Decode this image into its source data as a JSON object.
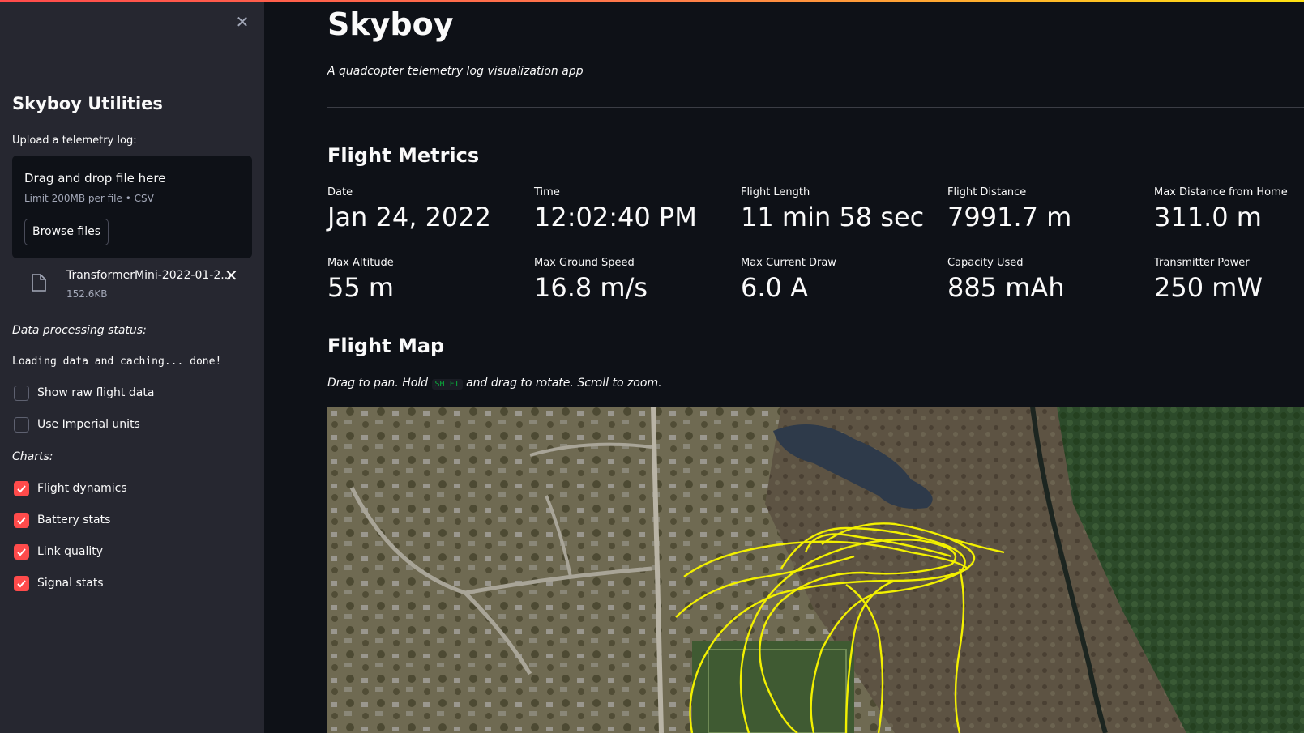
{
  "sidebar": {
    "title": "Skyboy Utilities",
    "upload_label": "Upload a telemetry log:",
    "dropzone": {
      "title": "Drag and drop file here",
      "limit": "Limit 200MB per file • CSV",
      "browse_label": "Browse files"
    },
    "file": {
      "name": "TransformerMini-2022-01-2...",
      "size": "152.6KB"
    },
    "status_label": "Data processing status:",
    "status_text": "Loading data and caching... done!",
    "options": [
      {
        "label": "Show raw flight data",
        "checked": false
      },
      {
        "label": "Use Imperial units",
        "checked": false
      }
    ],
    "charts_label": "Charts:",
    "charts": [
      {
        "label": "Flight dynamics",
        "checked": true
      },
      {
        "label": "Battery stats",
        "checked": true
      },
      {
        "label": "Link quality",
        "checked": true
      },
      {
        "label": "Signal stats",
        "checked": true
      }
    ]
  },
  "main": {
    "title": "Skyboy",
    "subtitle": "A quadcopter telemetry log visualization app",
    "metrics_heading": "Flight Metrics",
    "metrics": [
      {
        "label": "Date",
        "value": "Jan 24, 2022"
      },
      {
        "label": "Time",
        "value": "12:02:40 PM"
      },
      {
        "label": "Flight Length",
        "value": "11 min 58 sec"
      },
      {
        "label": "Flight Distance",
        "value": "7991.7 m"
      },
      {
        "label": "Max Distance from Home",
        "value": "311.0 m"
      },
      {
        "label": "Max Altitude",
        "value": "55 m"
      },
      {
        "label": "Max Ground Speed",
        "value": "16.8 m/s"
      },
      {
        "label": "Max Current Draw",
        "value": "6.0 A"
      },
      {
        "label": "Capacity Used",
        "value": "885 mAh"
      },
      {
        "label": "Transmitter Power",
        "value": "250 mW"
      }
    ],
    "map_heading": "Flight Map",
    "map_hint": {
      "part1": "Drag to pan. Hold ",
      "key": "SHIFT",
      "part2": " and drag to rotate. Scroll to zoom."
    }
  },
  "colors": {
    "accent": "#ff4b4b",
    "background": "#0e1117",
    "sidebar": "#262730",
    "flight_path": "#ffff00"
  }
}
